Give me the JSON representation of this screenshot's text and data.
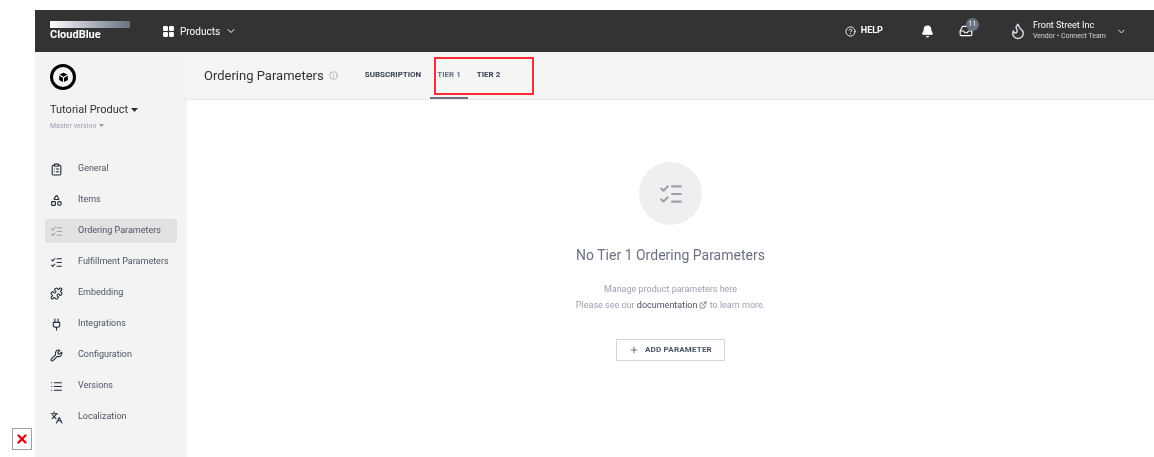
{
  "topbar": {
    "logo": "CloudBlue",
    "nav": "Products",
    "help": "HELP",
    "inbox_count": "11",
    "account": {
      "name": "Front Street Inc",
      "subtitle": "Vendor • Connect Team"
    }
  },
  "sidebar": {
    "product": "Tutorial Product",
    "version": "Master version",
    "items": [
      {
        "label": "General",
        "selected": false
      },
      {
        "label": "Items",
        "selected": false
      },
      {
        "label": "Ordering Parameters",
        "selected": true
      },
      {
        "label": "Fulfillment Parameters",
        "selected": false
      },
      {
        "label": "Embedding",
        "selected": false
      },
      {
        "label": "Integrations",
        "selected": false
      },
      {
        "label": "Configuration",
        "selected": false
      },
      {
        "label": "Versions",
        "selected": false
      },
      {
        "label": "Localization",
        "selected": false
      }
    ]
  },
  "page": {
    "title": "Ordering Parameters",
    "tabs": [
      {
        "label": "SUBSCRIPTION",
        "selected": false
      },
      {
        "label": "TIER 1",
        "selected": true
      },
      {
        "label": "TIER 2",
        "selected": false
      }
    ]
  },
  "empty_state": {
    "title": "No Tier 1 Ordering Parameters",
    "line1": "Manage product parameters here",
    "line2_before": "Please see our ",
    "link": "documentation",
    "line2_after": " to learn more.",
    "button": "ADD PARAMETER"
  }
}
